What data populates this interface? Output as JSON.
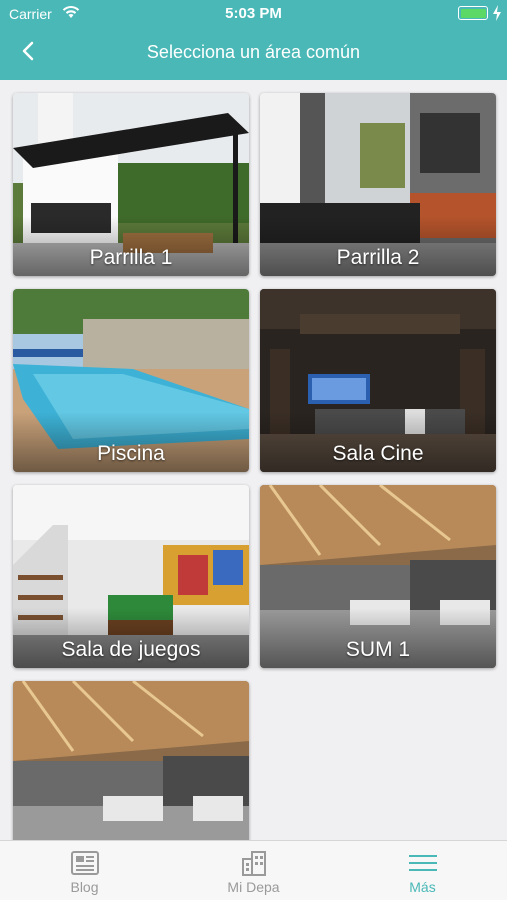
{
  "status_bar": {
    "carrier": "Carrier",
    "time": "5:03 PM",
    "battery_level": 1.0
  },
  "header": {
    "title": "Selecciona un área común"
  },
  "areas": [
    {
      "label": "Parrilla 1"
    },
    {
      "label": "Parrilla 2"
    },
    {
      "label": "Piscina"
    },
    {
      "label": "Sala Cine"
    },
    {
      "label": "Sala de juegos"
    },
    {
      "label": "SUM 1"
    },
    {
      "label": ""
    }
  ],
  "tab_bar": {
    "items": [
      {
        "label": "Blog",
        "icon": "newspaper-icon",
        "active": false
      },
      {
        "label": "Mi Depa",
        "icon": "building-icon",
        "active": false
      },
      {
        "label": "Más",
        "icon": "menu-icon",
        "active": true
      }
    ]
  },
  "colors": {
    "accent": "#4ab8b7",
    "inactive": "#9a9a9a",
    "battery": "#5bd865"
  }
}
